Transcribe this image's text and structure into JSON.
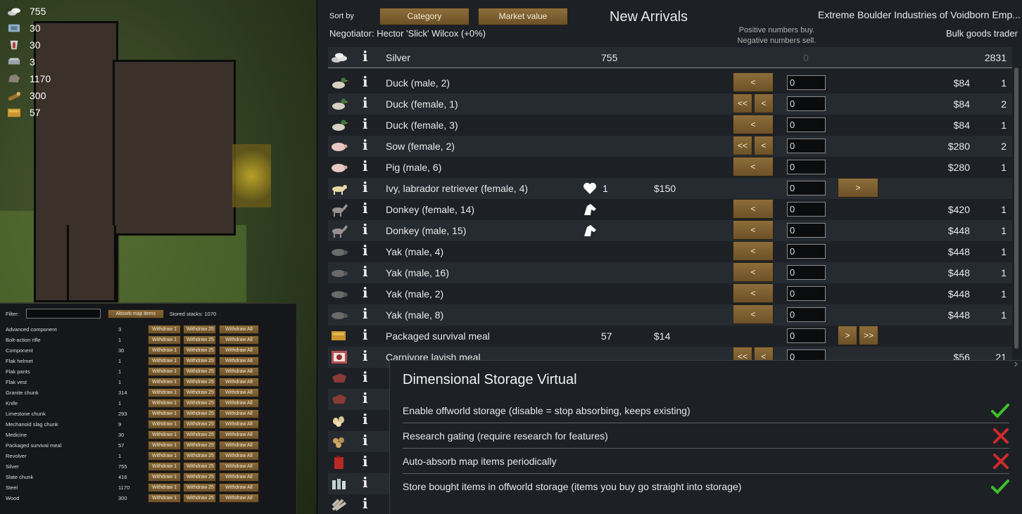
{
  "resources": [
    {
      "icon": "silver-icon",
      "value": "755"
    },
    {
      "icon": "component-icon",
      "value": "30"
    },
    {
      "icon": "medicine-icon",
      "value": "30"
    },
    {
      "icon": "steel-icon",
      "value": "3"
    },
    {
      "icon": "stone-chunk-icon",
      "value": "1170"
    },
    {
      "icon": "wood-icon",
      "value": "300"
    },
    {
      "icon": "meal-icon",
      "value": "57"
    }
  ],
  "storage": {
    "filter_label": "Filter:",
    "filter_value": "",
    "absorb_label": "Absorb map items",
    "stored_stacks": "Stored stacks: 1070",
    "btn1": "Withdraw 1",
    "btn25": "Withdraw 25",
    "btn_all": "Withdraw All",
    "items": [
      {
        "name": "Advanced component",
        "count": "3"
      },
      {
        "name": "Bolt-action rifle",
        "count": "1"
      },
      {
        "name": "Component",
        "count": "30"
      },
      {
        "name": "Flak helmet",
        "count": "1"
      },
      {
        "name": "Flak pants",
        "count": "1"
      },
      {
        "name": "Flak vest",
        "count": "1"
      },
      {
        "name": "Granite chunk",
        "count": "314"
      },
      {
        "name": "Knife",
        "count": "1"
      },
      {
        "name": "Limestone chunk",
        "count": "293"
      },
      {
        "name": "Mechanoid slag chunk",
        "count": "9"
      },
      {
        "name": "Medicine",
        "count": "30"
      },
      {
        "name": "Packaged survival meal",
        "count": "57"
      },
      {
        "name": "Revolver",
        "count": "1"
      },
      {
        "name": "Silver",
        "count": "755"
      },
      {
        "name": "Slate chunk",
        "count": "416"
      },
      {
        "name": "Steel",
        "count": "1170"
      },
      {
        "name": "Wood",
        "count": "300"
      }
    ]
  },
  "trade": {
    "sort_by": "Sort by",
    "sort_category": "Category",
    "sort_market": "Market value",
    "negotiator": "Negotiator: Hector 'Slick' Wilcox (+0%)",
    "title": "New Arrivals",
    "trader_name": "Extreme Boulder Industries of Voidborn Emp...",
    "trader_kind": "Bulk goods trader",
    "hint_line1": "Positive numbers buy.",
    "hint_line2": "Negative numbers sell.",
    "info_glyph": "i",
    "silver": {
      "name": "Silver",
      "colony": "755",
      "qty": "0",
      "trader": "2831"
    },
    "rows": [
      {
        "icon": "duck-icon",
        "name": "Duck (male, 2)",
        "left": "<",
        "qty": "0",
        "price": "$84",
        "trader": "1"
      },
      {
        "icon": "duck-icon",
        "name": "Duck (female, 1)",
        "left2": "<<",
        "left": "<",
        "qty": "0",
        "price": "$84",
        "trader": "2"
      },
      {
        "icon": "duck-icon",
        "name": "Duck (female, 3)",
        "left": "<",
        "qty": "0",
        "price": "$84",
        "trader": "1"
      },
      {
        "icon": "pig-icon",
        "name": "Sow (female, 2)",
        "left2": "<<",
        "left": "<",
        "qty": "0",
        "price": "$280",
        "trader": "2"
      },
      {
        "icon": "pig-icon",
        "name": "Pig (male, 6)",
        "left": "<",
        "qty": "0",
        "price": "$280",
        "trader": "1"
      },
      {
        "icon": "dog-icon",
        "name": "Ivy, labrador retriever (female, 4)",
        "bond": "1",
        "colony_price": "$150",
        "qty": "0",
        "right": ">"
      },
      {
        "icon": "donkey-icon",
        "name": "Donkey (female, 14)",
        "tame": true,
        "left": "<",
        "qty": "0",
        "price": "$420",
        "trader": "1"
      },
      {
        "icon": "donkey-icon",
        "name": "Donkey (male, 15)",
        "tame": true,
        "left": "<",
        "qty": "0",
        "price": "$448",
        "trader": "1"
      },
      {
        "icon": "yak-icon",
        "name": "Yak (male, 4)",
        "left": "<",
        "qty": "0",
        "price": "$448",
        "trader": "1"
      },
      {
        "icon": "yak-icon",
        "name": "Yak (male, 16)",
        "left": "<",
        "qty": "0",
        "price": "$448",
        "trader": "1"
      },
      {
        "icon": "yak-icon",
        "name": "Yak (male, 2)",
        "left": "<",
        "qty": "0",
        "price": "$448",
        "trader": "1"
      },
      {
        "icon": "yak-icon",
        "name": "Yak (male, 8)",
        "left": "<",
        "qty": "0",
        "price": "$448",
        "trader": "1"
      },
      {
        "icon": "meal-icon",
        "name": "Packaged survival meal",
        "colony": "57",
        "colony_price": "$14",
        "qty": "0",
        "right": ">",
        "right2": ">>"
      },
      {
        "icon": "lavish-meal-icon",
        "name": "Carnivore lavish meal",
        "left2": "<<",
        "left": "<",
        "qty": "0",
        "price": "$56",
        "trader": "21"
      },
      {
        "icon": "meat-icon",
        "name": "",
        "qty": "",
        "price": "",
        "trader": ""
      },
      {
        "icon": "meat-icon",
        "name": "",
        "qty": "",
        "price": "",
        "trader": ""
      },
      {
        "icon": "eggs-icon",
        "name": "",
        "qty": "",
        "price": "",
        "trader": ""
      },
      {
        "icon": "seeds-icon",
        "name": "",
        "qty": "",
        "price": "",
        "trader": ""
      },
      {
        "icon": "fuel-can-icon",
        "name": "",
        "qty": "",
        "price": "",
        "trader": ""
      },
      {
        "icon": "bottles-icon",
        "name": "",
        "qty": "",
        "price": "",
        "trader": ""
      },
      {
        "icon": "wool-icon",
        "name": "",
        "qty": "",
        "price": "",
        "trader": ""
      }
    ]
  },
  "dialog": {
    "title": "Dimensional Storage Virtual",
    "options": [
      {
        "label": "Enable offworld storage (disable = stop absorbing, keeps existing)",
        "state": "on"
      },
      {
        "label": "Research gating (require research for features)",
        "state": "off"
      },
      {
        "label": "Auto-absorb map items periodically",
        "state": "off"
      },
      {
        "label": "Store bought items in offworld storage (items you buy go straight into storage)",
        "state": "on"
      }
    ],
    "check_color": "#3fbf2a",
    "cross_color": "#d02a2a"
  }
}
